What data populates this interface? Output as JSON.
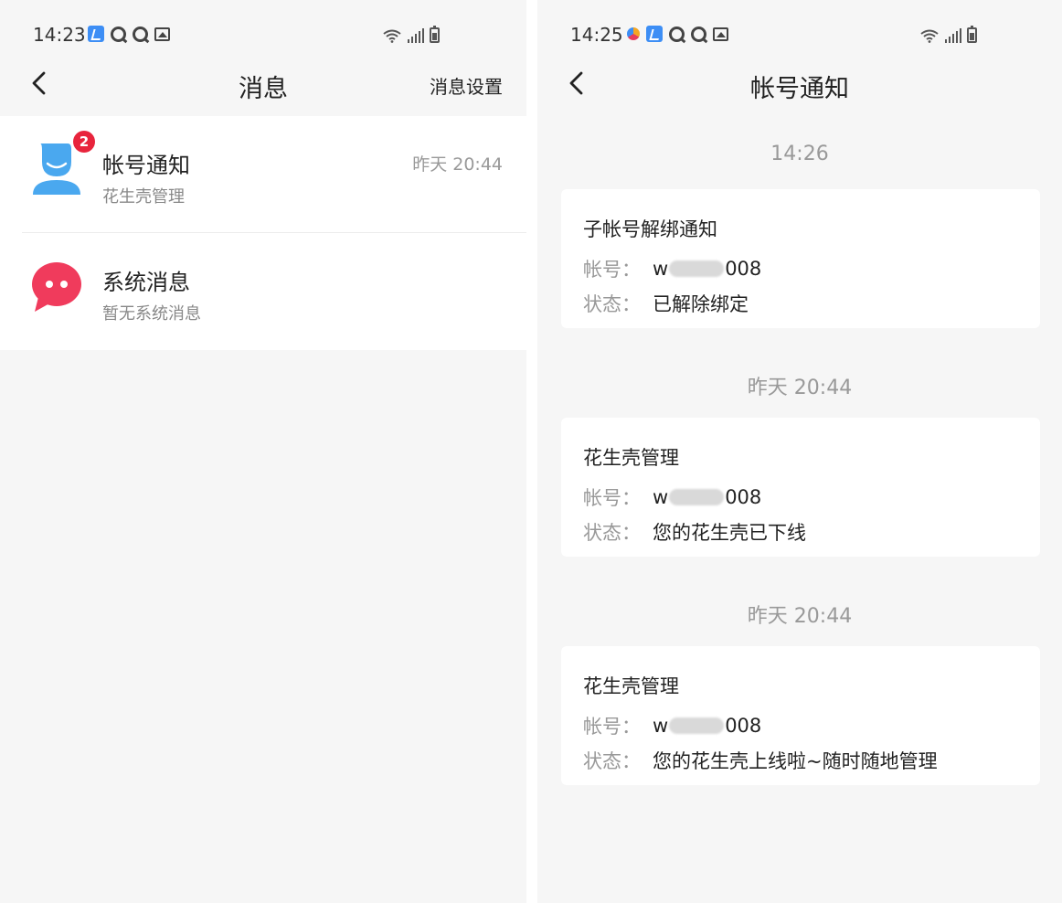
{
  "left_screen": {
    "status": {
      "time": "14:23"
    },
    "nav": {
      "title": "消息",
      "action": "消息设置"
    },
    "messages": [
      {
        "title": "帐号通知",
        "subtitle": "花生壳管理",
        "time": "昨天 20:44",
        "badge": "2",
        "icon": "user-avatar-icon",
        "color": "#4aa8ef"
      },
      {
        "title": "系统消息",
        "subtitle": "暂无系统消息",
        "time": "",
        "icon": "chat-bubble-icon",
        "color": "#f03b5c"
      }
    ]
  },
  "right_screen": {
    "status": {
      "time": "14:25"
    },
    "nav": {
      "title": "帐号通知"
    },
    "notifications": [
      {
        "time": "14:26",
        "title": "子帐号解绑通知",
        "account_label": "帐号：",
        "account_prefix": "w",
        "account_suffix": "008",
        "status_label": "状态：",
        "status_value": "已解除绑定"
      },
      {
        "time": "昨天 20:44",
        "title": "花生壳管理",
        "account_label": "帐号：",
        "account_prefix": "w",
        "account_suffix": "008",
        "status_label": "状态：",
        "status_value": "您的花生壳已下线"
      },
      {
        "time": "昨天 20:44",
        "title": "花生壳管理",
        "account_label": "帐号：",
        "account_prefix": "w",
        "account_suffix": "008",
        "status_label": "状态：",
        "status_value": "您的花生壳上线啦~随时随地管理"
      }
    ]
  }
}
